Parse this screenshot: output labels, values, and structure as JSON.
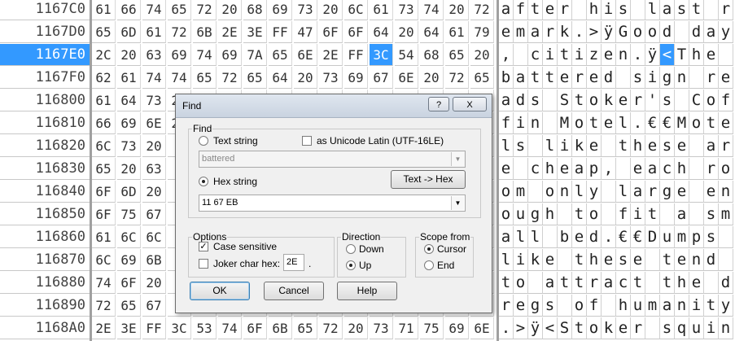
{
  "hex_rows": [
    {
      "addr": "1167C0",
      "hex": [
        "61",
        "66",
        "74",
        "65",
        "72",
        "20",
        "68",
        "69",
        "73",
        "20",
        "6C",
        "61",
        "73",
        "74",
        "20",
        "72"
      ],
      "ascii": [
        "a",
        "f",
        "t",
        "e",
        "r",
        " ",
        "h",
        "i",
        "s",
        " ",
        "l",
        "a",
        "s",
        "t",
        " ",
        "r"
      ]
    },
    {
      "addr": "1167D0",
      "hex": [
        "65",
        "6D",
        "61",
        "72",
        "6B",
        "2E",
        "3E",
        "FF",
        "47",
        "6F",
        "6F",
        "64",
        "20",
        "64",
        "61",
        "79"
      ],
      "ascii": [
        "e",
        "m",
        "a",
        "r",
        "k",
        ".",
        ">",
        "ÿ",
        "G",
        "o",
        "o",
        "d",
        " ",
        "d",
        "a",
        "y"
      ]
    },
    {
      "addr": "1167E0",
      "hex": [
        "2C",
        "20",
        "63",
        "69",
        "74",
        "69",
        "7A",
        "65",
        "6E",
        "2E",
        "FF",
        "3C",
        "54",
        "68",
        "65",
        "20"
      ],
      "ascii": [
        ",",
        " ",
        "c",
        "i",
        "t",
        "i",
        "z",
        "e",
        "n",
        ".",
        "ÿ",
        "<",
        "T",
        "h",
        "e",
        " "
      ]
    },
    {
      "addr": "1167F0",
      "hex": [
        "62",
        "61",
        "74",
        "74",
        "65",
        "72",
        "65",
        "64",
        "20",
        "73",
        "69",
        "67",
        "6E",
        "20",
        "72",
        "65"
      ],
      "ascii": [
        "b",
        "a",
        "t",
        "t",
        "e",
        "r",
        "e",
        "d",
        " ",
        "s",
        "i",
        "g",
        "n",
        " ",
        "r",
        "e"
      ]
    },
    {
      "addr": "116800",
      "hex": [
        "61",
        "64",
        "73",
        "20",
        "",
        "",
        "",
        "",
        "",
        "",
        "",
        "",
        "",
        "",
        "",
        ""
      ],
      "ascii": [
        "a",
        "d",
        "s",
        " ",
        "S",
        "t",
        "o",
        "k",
        "e",
        "r",
        "'",
        "s",
        " ",
        "C",
        "o",
        "f"
      ]
    },
    {
      "addr": "116810",
      "hex": [
        "66",
        "69",
        "6E",
        "20",
        "",
        "",
        "",
        "",
        "",
        "",
        "",
        "",
        "",
        "",
        "",
        ""
      ],
      "ascii": [
        "f",
        "i",
        "n",
        " ",
        "M",
        "o",
        "t",
        "e",
        "l",
        ".",
        "€",
        "€",
        "M",
        "o",
        "t",
        "e"
      ]
    },
    {
      "addr": "116820",
      "hex": [
        "6C",
        "73",
        "20",
        "",
        "",
        "",
        "",
        "",
        "",
        "",
        "",
        "",
        "",
        "",
        "",
        ""
      ],
      "ascii": [
        "l",
        "s",
        " ",
        "l",
        "i",
        "k",
        "e",
        " ",
        "t",
        "h",
        "e",
        "s",
        "e",
        " ",
        "a",
        "r"
      ]
    },
    {
      "addr": "116830",
      "hex": [
        "65",
        "20",
        "63",
        "",
        "",
        "",
        "",
        "",
        "",
        "",
        "",
        "",
        "",
        "",
        "",
        ""
      ],
      "ascii": [
        "e",
        " ",
        "c",
        "h",
        "e",
        "a",
        "p",
        ",",
        " ",
        "e",
        "a",
        "c",
        "h",
        " ",
        "r",
        "o"
      ]
    },
    {
      "addr": "116840",
      "hex": [
        "6F",
        "6D",
        "20",
        "",
        "",
        "",
        "",
        "",
        "",
        "",
        "",
        "",
        "",
        "",
        "",
        ""
      ],
      "ascii": [
        "o",
        "m",
        " ",
        "o",
        "n",
        "l",
        "y",
        " ",
        "l",
        "a",
        "r",
        "g",
        "e",
        " ",
        "e",
        "n"
      ]
    },
    {
      "addr": "116850",
      "hex": [
        "6F",
        "75",
        "67",
        "",
        "",
        "",
        "",
        "",
        "",
        "",
        "",
        "",
        "",
        "",
        "",
        ""
      ],
      "ascii": [
        "o",
        "u",
        "g",
        "h",
        " ",
        "t",
        "o",
        " ",
        "f",
        "i",
        "t",
        " ",
        "a",
        " ",
        "s",
        "m"
      ]
    },
    {
      "addr": "116860",
      "hex": [
        "61",
        "6C",
        "6C",
        "",
        "",
        "",
        "",
        "",
        "",
        "",
        "",
        "",
        "",
        "",
        "",
        ""
      ],
      "ascii": [
        "a",
        "l",
        "l",
        " ",
        "b",
        "e",
        "d",
        ".",
        "€",
        "€",
        "D",
        "u",
        "m",
        "p",
        "s",
        " "
      ]
    },
    {
      "addr": "116870",
      "hex": [
        "6C",
        "69",
        "6B",
        "",
        "",
        "",
        "",
        "",
        "",
        "",
        "",
        "",
        "",
        "",
        "",
        ""
      ],
      "ascii": [
        "l",
        "i",
        "k",
        "e",
        " ",
        "t",
        "h",
        "e",
        "s",
        "e",
        " ",
        "t",
        "e",
        "n",
        "d",
        " "
      ]
    },
    {
      "addr": "116880",
      "hex": [
        "74",
        "6F",
        "20",
        "",
        "",
        "",
        "",
        "",
        "",
        "",
        "",
        "",
        "",
        "",
        "",
        ""
      ],
      "ascii": [
        "t",
        "o",
        " ",
        "a",
        "t",
        "t",
        "r",
        "a",
        "c",
        "t",
        " ",
        "t",
        "h",
        "e",
        " ",
        "d"
      ]
    },
    {
      "addr": "116890",
      "hex": [
        "72",
        "65",
        "67",
        "",
        "",
        "",
        "",
        "",
        "",
        "",
        "",
        "",
        "",
        "",
        "",
        ""
      ],
      "ascii": [
        "r",
        "e",
        "g",
        "s",
        " ",
        "o",
        "f",
        " ",
        "h",
        "u",
        "m",
        "a",
        "n",
        "i",
        "t",
        "y"
      ]
    },
    {
      "addr": "1168A0",
      "hex": [
        "2E",
        "3E",
        "FF",
        "3C",
        "53",
        "74",
        "6F",
        "6B",
        "65",
        "72",
        "20",
        "73",
        "71",
        "75",
        "69",
        "6E"
      ],
      "ascii": [
        ".",
        ">",
        "ÿ",
        "<",
        "S",
        "t",
        "o",
        "k",
        "e",
        "r",
        " ",
        "s",
        "q",
        "u",
        "i",
        "n"
      ]
    }
  ],
  "selected_row": 2,
  "selected_col": 11,
  "colors": {
    "selection": "#3399ff",
    "grid": "#c8c8c8"
  },
  "find_dialog": {
    "title": "Find",
    "help_btn": "?",
    "close_btn": "X",
    "find_group": "Find",
    "text_string_label": "Text string",
    "unicode_label": "as Unicode Latin (UTF-16LE)",
    "text_value": "battered",
    "hex_string_label": "Hex string",
    "text_to_hex_button": "Text -> Hex",
    "hex_value": "11 67 EB",
    "options_group": "Options",
    "case_sensitive_label": "Case sensitive",
    "joker_label": "Joker char hex:",
    "joker_value": "2E",
    "joker_dot": ".",
    "direction_group": "Direction",
    "down_label": "Down",
    "up_label": "Up",
    "scope_group": "Scope from",
    "cursor_label": "Cursor",
    "end_label": "End",
    "ok_label": "OK",
    "cancel_label": "Cancel",
    "help_label": "Help"
  }
}
